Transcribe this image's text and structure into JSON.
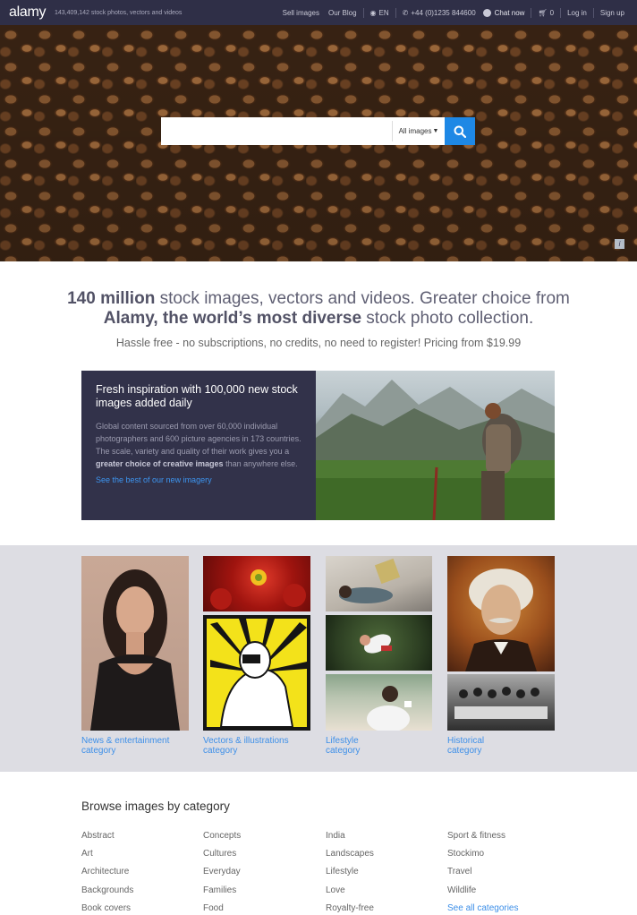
{
  "topbar": {
    "logo": "alamy",
    "tagline": "143,409,142  stock photos, vectors and videos",
    "sell_images": "Sell images",
    "our_blog": "Our Blog",
    "language": "EN",
    "phone": "+44 (0)1235 844600",
    "chat": "Chat now",
    "cart_count": "0",
    "login": "Log in",
    "signup": "Sign up"
  },
  "search": {
    "value": "",
    "filter": "All images"
  },
  "headline": {
    "bold1": "140 million",
    "text1": " stock images, vectors and videos. Greater choice from ",
    "bold2": "Alamy, the world’s most diverse",
    "text2": " stock photo collection.",
    "subline": "Hassle free - no subscriptions, no credits, no need to register! Pricing from $19.99"
  },
  "feature": {
    "title": "Fresh inspiration with 100,000 new stock images added daily",
    "body1": "Global content sourced from over 60,000 individual photographers and 600 picture agencies in 173 countries. The scale, variety and quality of their work gives you a ",
    "body_bold": "greater choice of creative images",
    "body2": " than anywhere else.",
    "link": "See the best of our new imagery"
  },
  "gallery": [
    {
      "label1": "News & entertainment",
      "label2": "category"
    },
    {
      "label1": "Vectors & illustrations",
      "label2": "category"
    },
    {
      "label1": "Lifestyle",
      "label2": "category"
    },
    {
      "label1": "Historical",
      "label2": "category"
    }
  ],
  "browse": {
    "title": "Browse images by category",
    "columns": [
      [
        "Abstract",
        "Art",
        "Architecture",
        "Backgrounds",
        "Book covers"
      ],
      [
        "Concepts",
        "Cultures",
        "Everyday",
        "Families",
        "Food"
      ],
      [
        "India",
        "Landscapes",
        "Lifestyle",
        "Love",
        "Royalty-free"
      ],
      [
        "Sport & fitness",
        "Stockimo",
        "Travel",
        "Wildlife",
        "See all categories"
      ]
    ]
  },
  "colors": {
    "topbar": "#2f2f47",
    "accent": "#1e88e5",
    "link": "#3d8fe8",
    "feature_panel": "#32324a",
    "gallery_bg": "#dddde3"
  }
}
